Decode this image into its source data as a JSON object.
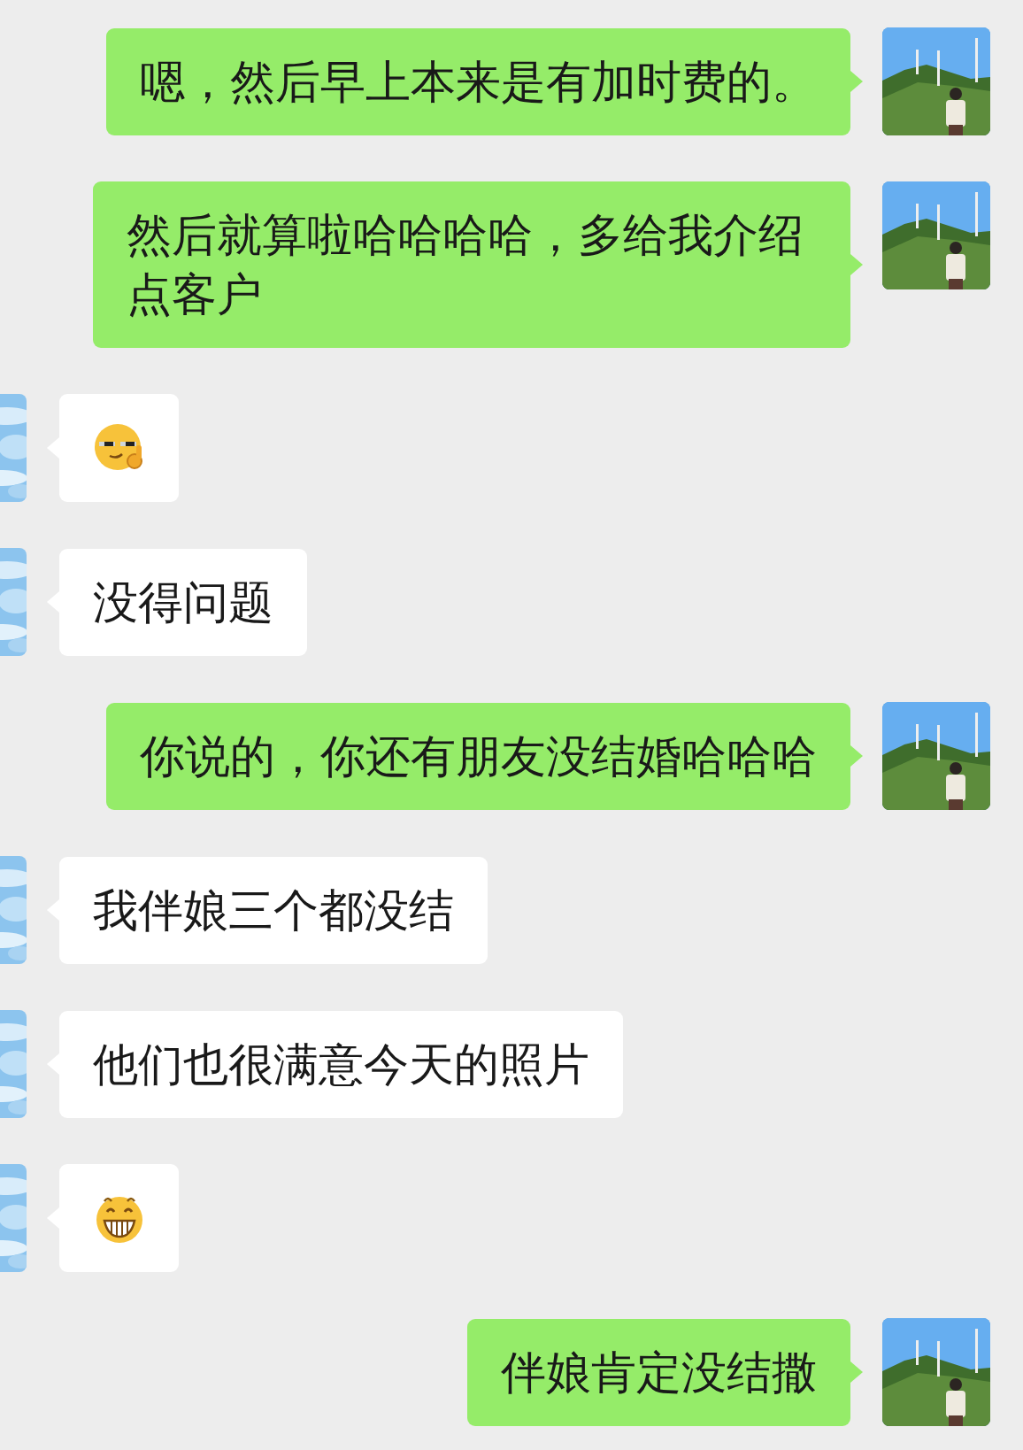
{
  "messages": [
    {
      "kind": "sent",
      "text": "嗯，然后早上本来是有加时费的。"
    },
    {
      "kind": "sent",
      "text": "然后就算啦哈哈哈哈，多给我介绍点客户"
    },
    {
      "kind": "smirk"
    },
    {
      "kind": "received",
      "text": "没得问题"
    },
    {
      "kind": "sent",
      "text": "你说的，你还有朋友没结婚哈哈哈"
    },
    {
      "kind": "received",
      "text": "我伴娘三个都没结"
    },
    {
      "kind": "received",
      "text": "他们也很满意今天的照片"
    },
    {
      "kind": "grin"
    },
    {
      "kind": "sent",
      "text": "伴娘肯定没结撒"
    }
  ]
}
